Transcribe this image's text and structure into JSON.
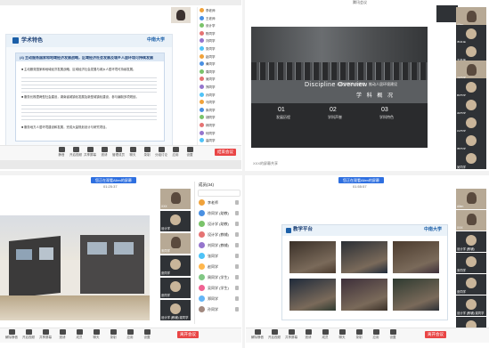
{
  "q1": {
    "slide_title": "学术特色",
    "logo_text": "中南大学",
    "heading": "(4) 主动服务国家和地域经济发展战略，区域经济社会发展及城乡人居环境可持续发展",
    "paragraphs": [
      "■ 主动服务国家和地域经济发展战略、区域经济社会发展与城乡人居环境可持续发展。",
      "■ 服务长株潭两型社会建设，湖南省城镇化发展及新型城镇化建设，参与编制多项规划。",
      "■ 服务地方人居环境建设和发展，完成大量规划设计与研究项目。"
    ],
    "toolbar": [
      "静音",
      "开启视频",
      "共享屏幕",
      "邀请",
      "管理成员",
      "聊天",
      "录制",
      "分组讨论",
      "应用",
      "设置"
    ],
    "end_label": "结束会议",
    "participants": [
      {
        "name": "李老师"
      },
      {
        "name": "王老师"
      },
      {
        "name": "设计学"
      },
      {
        "name": "陈同学"
      },
      {
        "name": "刘同学"
      },
      {
        "name": "张同学"
      },
      {
        "name": "赵同学"
      },
      {
        "name": "黄同学"
      },
      {
        "name": "周同学"
      },
      {
        "name": "吴同学"
      },
      {
        "name": "郑同学"
      },
      {
        "name": "孙同学"
      },
      {
        "name": "马同学"
      },
      {
        "name": "朱同学"
      },
      {
        "name": "胡同学"
      },
      {
        "name": "林同学"
      },
      {
        "name": "何同学"
      },
      {
        "name": "高同学"
      }
    ]
  },
  "q2": {
    "top_title": "腾讯会议",
    "hero_text": "Discipline Overview",
    "hero_cn": "学 科 概 况",
    "hero_sub": "本校学科专业优势，推动人居环境建设",
    "stats": [
      {
        "num": "01",
        "label": "发展历程"
      },
      {
        "num": "02",
        "label": "学科声誉"
      },
      {
        "num": "03",
        "label": "学科特色"
      }
    ],
    "share_label": "XXX的屏幕共享",
    "tiles": [
      "Allen",
      "李老师",
      "王老师",
      "刘同学",
      "陈同学",
      "张同学",
      "赵同学",
      "周同学",
      "吴同学"
    ]
  },
  "q3": {
    "share_banner": "您正在观看Allen的屏幕",
    "rec": "01:25:37",
    "toolbar": [
      "解除静音",
      "开启视频",
      "共享屏幕",
      "邀请",
      "成员",
      "聊天",
      "录制",
      "应用",
      "设置"
    ],
    "end_label": "离开会议",
    "tiles": [
      "XXX",
      "设计学",
      "宋同学",
      "张同学",
      "张同学",
      "设计学 (教辅) 梁同学"
    ],
    "list_title": "成员(34)",
    "list": [
      {
        "name": "李老师",
        "color": "#f0a23b"
      },
      {
        "name": "徐同学 (助教)",
        "color": "#4a90e2"
      },
      {
        "name": "设计学 (助教)",
        "color": "#7ac36a"
      },
      {
        "name": "设计学 (教辅)",
        "color": "#e57373"
      },
      {
        "name": "刘同学 (教辅)",
        "color": "#9575cd"
      },
      {
        "name": "张同学",
        "color": "#4fc3f7"
      },
      {
        "name": "赵同学",
        "color": "#ffb74d"
      },
      {
        "name": "周同学 (学生)",
        "color": "#81c784"
      },
      {
        "name": "吴同学 (学生)",
        "color": "#f06292"
      },
      {
        "name": "郑同学",
        "color": "#64b5f6"
      },
      {
        "name": "孙同学",
        "color": "#a1887f"
      }
    ]
  },
  "q4": {
    "share_banner": "您正在观看Allen的屏幕",
    "rec": "01:55:57",
    "slide_title": "教学平台",
    "logo_text": "中南大学",
    "toolbar": [
      "解除静音",
      "开启视频",
      "共享屏幕",
      "邀请",
      "成员",
      "聊天",
      "录制",
      "应用",
      "设置"
    ],
    "end_label": "离开会议",
    "tiles": [
      "Allen",
      "XXX",
      "设计学 (教辅)",
      "宋同学",
      "张同学",
      "设计学 (教辅) 梁同学",
      "陈同学"
    ]
  }
}
